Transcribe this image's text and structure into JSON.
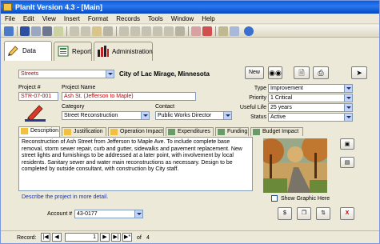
{
  "window": {
    "title": "PlanIt Version 4.3 - [Main]"
  },
  "menu": [
    "File",
    "Edit",
    "View",
    "Insert",
    "Format",
    "Records",
    "Tools",
    "Window",
    "Help"
  ],
  "toolbar_icons": [
    "design-view-icon",
    "save-icon",
    "print-preview-icon",
    "print-icon",
    "spelling-icon",
    "cut-icon",
    "copy-icon",
    "paste-icon",
    "undo-icon",
    "sort-ascending-icon",
    "sort-descending-icon",
    "filter-selection-icon",
    "filter-form-icon",
    "apply-filter-icon",
    "find-icon",
    "new-record-icon",
    "delete-record-icon",
    "database-window-icon",
    "new-object-icon",
    "help-icon"
  ],
  "nav_tabs": [
    {
      "label": "Data",
      "icon": "data-icon"
    },
    {
      "label": "Report",
      "icon": "report-icon"
    },
    {
      "label": "Administration",
      "icon": "administration-icon"
    }
  ],
  "header": {
    "category_select": "Streets",
    "city": "City of Lac Mirage, Minnesota",
    "new_button": "New"
  },
  "project": {
    "number_label": "Project #",
    "number": "STR-07-001",
    "name_label": "Project Name",
    "name": "Ash St. (Jefferson to Maple)",
    "category_label": "Category",
    "category": "Street Reconstruction",
    "contact_label": "Contact",
    "contact": "Public Works Director",
    "type_label": "Type",
    "type": "Improvement",
    "priority_label": "Priority",
    "priority": "1 Critical",
    "useful_life_label": "Useful Life",
    "useful_life": "25 years",
    "status_label": "Status",
    "status": "Active"
  },
  "sub_tabs": [
    "Description",
    "Justification",
    "Operation Impact",
    "Expenditures",
    "Funding",
    "Budget Impact"
  ],
  "description": {
    "text": "Reconstruction of Ash Street from Jefferson to Maple Ave.  To include complete base removal, storm sewer repair, curb and gutter, sidewalks and pavement replacement.  New street lights and furnishings to be addressed at a later point, with involvement by local residents.  Sanitary sewer and water main reconstructions as necessary.  Design to be completed by outside consultant, with construction by City staff.",
    "hint": "Describe the project in more detail.",
    "show_graphic_label": "Show Graphic Here",
    "account_label": "Account #",
    "account": "43-0177"
  },
  "record_nav": {
    "label": "Record:",
    "current": "1",
    "of_text": "of",
    "total": "4"
  },
  "colors": {
    "title_bar": "#0a5ed8",
    "project_number": "#c00000",
    "link": "#1030c0"
  }
}
